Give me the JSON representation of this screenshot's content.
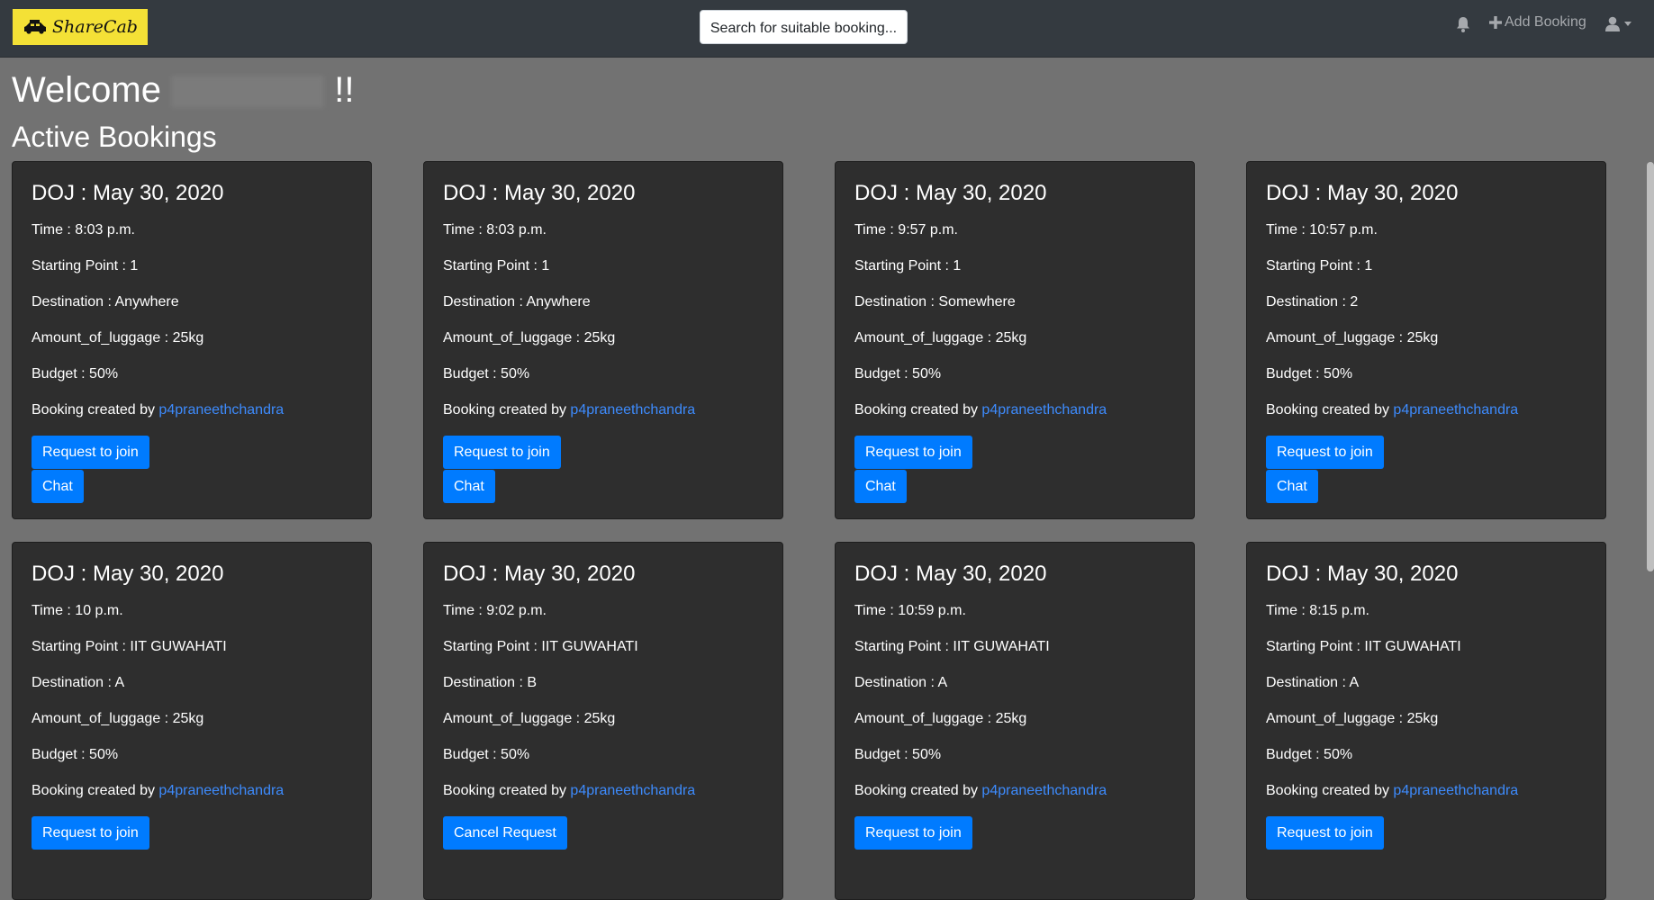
{
  "nav": {
    "brand": "ShareCab",
    "search_label": "Search for suitable booking...",
    "add_booking": "Add Booking"
  },
  "welcome": {
    "prefix": "Welcome",
    "suffix": "!!"
  },
  "section_title": "Active Bookings",
  "bookings": [
    {
      "doj": "DOJ : May 30, 2020",
      "time": "Time : 8:03 p.m.",
      "start": "Starting Point : 1",
      "dest": "Destination : Anywhere",
      "luggage": "Amount_of_luggage : 25kg",
      "budget": "Budget : 50%",
      "created_by": "Booking created by ",
      "user": "p4praneethchandra",
      "action": "Request to join",
      "chat": "Chat"
    },
    {
      "doj": "DOJ : May 30, 2020",
      "time": "Time : 8:03 p.m.",
      "start": "Starting Point : 1",
      "dest": "Destination : Anywhere",
      "luggage": "Amount_of_luggage : 25kg",
      "budget": "Budget : 50%",
      "created_by": "Booking created by ",
      "user": "p4praneethchandra",
      "action": "Request to join",
      "chat": "Chat"
    },
    {
      "doj": "DOJ : May 30, 2020",
      "time": "Time : 9:57 p.m.",
      "start": "Starting Point : 1",
      "dest": "Destination : Somewhere",
      "luggage": "Amount_of_luggage : 25kg",
      "budget": "Budget : 50%",
      "created_by": "Booking created by ",
      "user": "p4praneethchandra",
      "action": "Request to join",
      "chat": "Chat"
    },
    {
      "doj": "DOJ : May 30, 2020",
      "time": "Time : 10:57 p.m.",
      "start": "Starting Point : 1",
      "dest": "Destination : 2",
      "luggage": "Amount_of_luggage : 25kg",
      "budget": "Budget : 50%",
      "created_by": "Booking created by ",
      "user": "p4praneethchandra",
      "action": "Request to join",
      "chat": "Chat"
    },
    {
      "doj": "DOJ : May 30, 2020",
      "time": "Time : 10 p.m.",
      "start": "Starting Point : IIT GUWAHATI",
      "dest": "Destination : A",
      "luggage": "Amount_of_luggage : 25kg",
      "budget": "Budget : 50%",
      "created_by": "Booking created by ",
      "user": "p4praneethchandra",
      "action": "Request to join"
    },
    {
      "doj": "DOJ : May 30, 2020",
      "time": "Time : 9:02 p.m.",
      "start": "Starting Point : IIT GUWAHATI",
      "dest": "Destination : B",
      "luggage": "Amount_of_luggage : 25kg",
      "budget": "Budget : 50%",
      "created_by": "Booking created by ",
      "user": "p4praneethchandra",
      "action": "Cancel Request"
    },
    {
      "doj": "DOJ : May 30, 2020",
      "time": "Time : 10:59 p.m.",
      "start": "Starting Point : IIT GUWAHATI",
      "dest": "Destination : A",
      "luggage": "Amount_of_luggage : 25kg",
      "budget": "Budget : 50%",
      "created_by": "Booking created by ",
      "user": "p4praneethchandra",
      "action": "Request to join"
    },
    {
      "doj": "DOJ : May 30, 2020",
      "time": "Time : 8:15 p.m.",
      "start": "Starting Point : IIT GUWAHATI",
      "dest": "Destination : A",
      "luggage": "Amount_of_luggage : 25kg",
      "budget": "Budget : 50%",
      "created_by": "Booking created by ",
      "user": "p4praneethchandra",
      "action": "Request to join"
    }
  ],
  "colors": {
    "navbar": "#343a40",
    "logo_bg": "#f4e136",
    "card_bg": "#2e2e2e",
    "page_bg": "#727272",
    "primary": "#007bff",
    "link": "#3d8bfd"
  },
  "icons": {
    "logo": "car-icon",
    "bell": "bell-icon",
    "add": "plus-icon",
    "user": "user-icon",
    "caret": "caret-down-icon"
  }
}
